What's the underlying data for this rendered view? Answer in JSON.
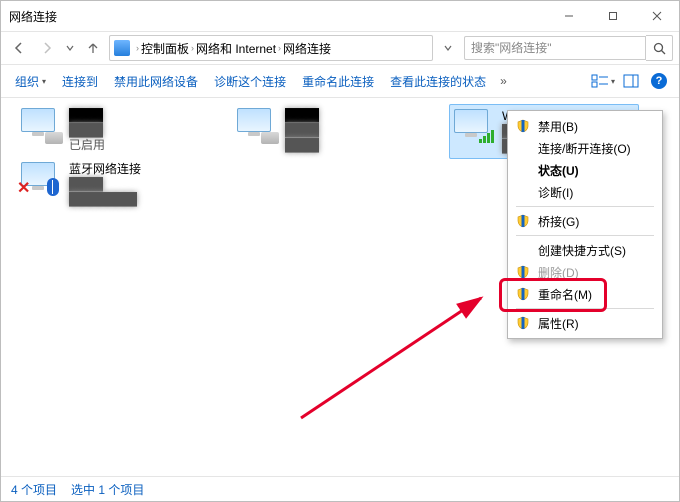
{
  "title": "网络连接",
  "breadcrumbs": {
    "a": "控制面板",
    "b": "网络和 Internet",
    "c": "网络连接"
  },
  "search_placeholder": "搜索\"网络连接\"",
  "toolbar": {
    "organize": "组织",
    "connect_to": "连接到",
    "disable": "禁用此网络设备",
    "diagnose": "诊断这个连接",
    "rename": "重命名此连接",
    "status": "查看此连接的状态"
  },
  "connections": {
    "eth1": {
      "name": "",
      "status": "已启用"
    },
    "eth2": {
      "name": "",
      "status": ""
    },
    "bt": {
      "name": "蓝牙网络连接",
      "status": ""
    },
    "wlan": {
      "name": "WLAN",
      "status": ""
    }
  },
  "context_menu": {
    "disable": "禁用(B)",
    "connect": "连接/断开连接(O)",
    "status": "状态(U)",
    "diagnose": "诊断(I)",
    "bridge": "桥接(G)",
    "shortcut": "创建快捷方式(S)",
    "delete": "删除(D)",
    "rename": "重命名(M)",
    "properties": "属性(R)"
  },
  "statusbar": {
    "count": "4 个项目",
    "selected": "选中 1 个项目"
  }
}
